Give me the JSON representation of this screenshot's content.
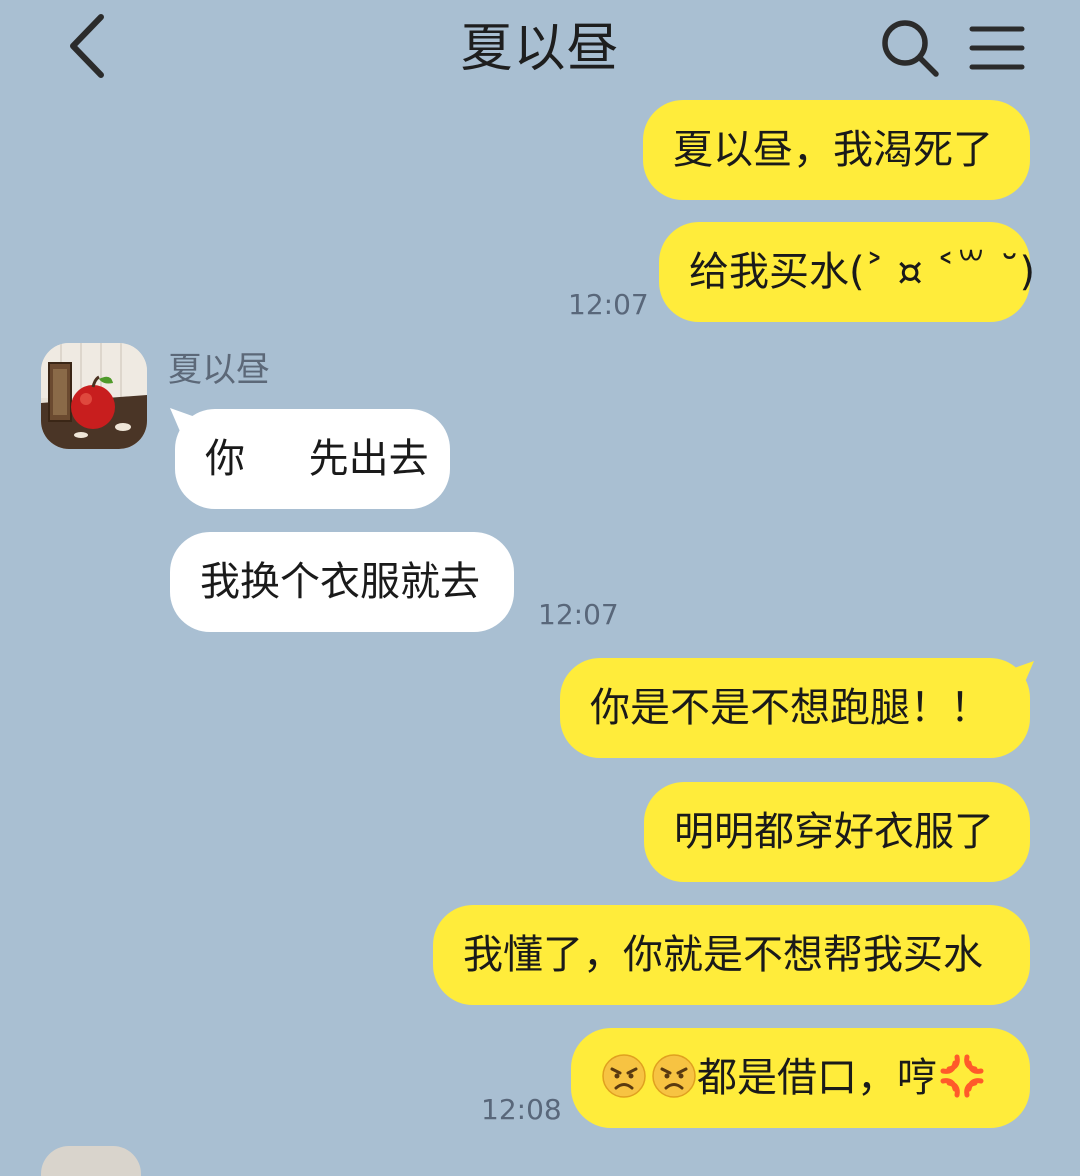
{
  "header": {
    "title": "夏以昼"
  },
  "messages": {
    "m1": "夏以昼，我渴死了",
    "m2": "给我买水(˃ ¤ ˂꒳ ˘)",
    "t1": "12:07",
    "sender_name": "夏以昼",
    "m3": "你     先出去",
    "m4": "我换个衣服就去",
    "t2": "12:07",
    "m5": "你是不是不想跑腿！！",
    "m6": "明明都穿好衣服了",
    "m7": "我懂了，你就是不想帮我买水",
    "m8_text": "都是借口，哼",
    "t3": "12:08"
  },
  "colors": {
    "background": "#a9bfd2",
    "outgoing_bubble": "#ffec3b",
    "incoming_bubble": "#ffffff"
  },
  "icons": {
    "back": "chevron-left-icon",
    "search": "search-icon",
    "menu": "menu-icon",
    "angry": "angry-face-icon",
    "anger_symbol": "anger-symbol-icon"
  }
}
